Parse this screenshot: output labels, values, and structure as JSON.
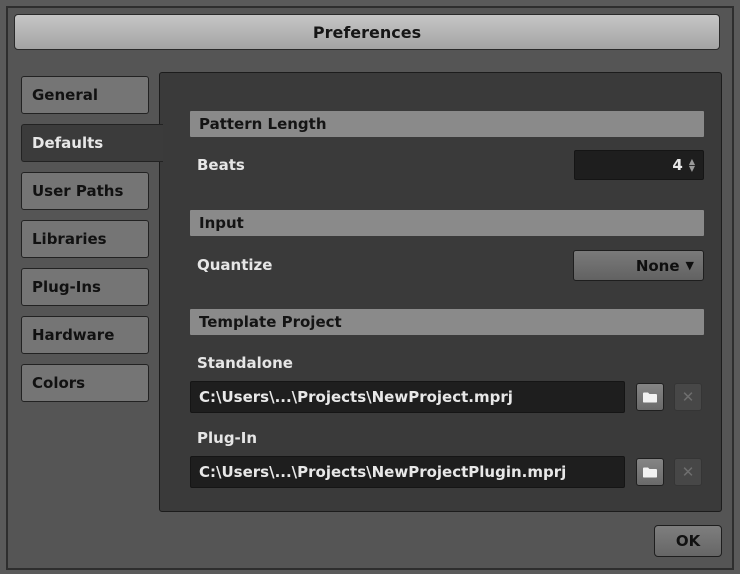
{
  "window": {
    "title": "Preferences"
  },
  "tabs": [
    {
      "label": "General"
    },
    {
      "label": "Defaults",
      "active": true
    },
    {
      "label": "User Paths"
    },
    {
      "label": "Libraries"
    },
    {
      "label": "Plug-Ins"
    },
    {
      "label": "Hardware"
    },
    {
      "label": "Colors"
    }
  ],
  "pattern_length": {
    "header": "Pattern Length",
    "beats_label": "Beats",
    "beats_value": "4"
  },
  "input": {
    "header": "Input",
    "quantize_label": "Quantize",
    "quantize_value": "None"
  },
  "template_project": {
    "header": "Template Project",
    "standalone_label": "Standalone",
    "standalone_path": "C:\\Users\\...\\Projects\\NewProject.mprj",
    "plugin_label": "Plug-In",
    "plugin_path": "C:\\Users\\...\\Projects\\NewProjectPlugin.mprj"
  },
  "buttons": {
    "ok": "OK"
  },
  "icons": {
    "folder": "folder-icon",
    "clear": "close-icon",
    "stepper": "up-down-arrows-icon",
    "dropdown": "caret-down-icon"
  }
}
